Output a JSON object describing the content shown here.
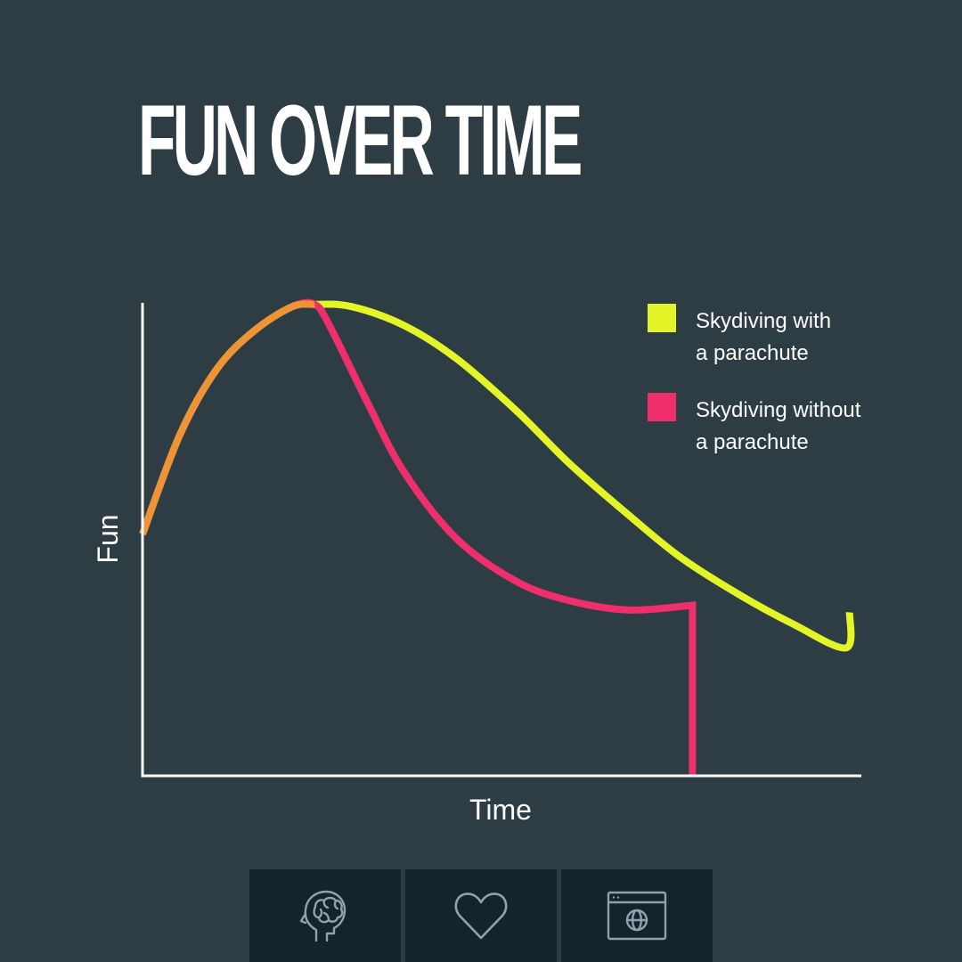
{
  "colors": {
    "background": "#2e3c44",
    "axis": "#ffffff",
    "text": "#ffffff",
    "icon_tile": "#14232c",
    "icon_stroke": "#8fa3ad"
  },
  "chart_data": {
    "type": "line",
    "title": "FUN OVER TIME",
    "xlabel": "Time",
    "ylabel": "Fun",
    "xlim": [
      0,
      100
    ],
    "ylim": [
      0,
      100
    ],
    "grid": false,
    "tick_labels": false,
    "legend_position": "top-right",
    "series": [
      {
        "name": "Skydiving with\na parachute",
        "name_lines": [
          "Skydiving with",
          "a parachute"
        ],
        "color": "#e4f527",
        "x": [
          0,
          5,
          10,
          15,
          20,
          23,
          28,
          35,
          42,
          50,
          57,
          65,
          72,
          80,
          87,
          94,
          99
        ],
        "y": [
          51,
          72,
          86,
          94,
          99,
          99.5,
          99,
          95,
          88,
          77,
          66,
          55,
          46,
          38,
          32,
          27,
          34.5
        ]
      },
      {
        "name": "Skydiving without\na parachute",
        "name_lines": [
          "Skydiving without",
          "a parachute"
        ],
        "color": "#ef2f6c",
        "x": [
          0,
          5,
          10,
          15,
          20,
          23,
          25,
          30,
          35,
          42,
          50,
          57,
          65,
          73.5,
          73.5
        ],
        "y": [
          51,
          72,
          86,
          94,
          99,
          99.5,
          95,
          79,
          64,
          50,
          41,
          37,
          35,
          36,
          0
        ]
      }
    ],
    "overlap_color": "#ec9436"
  },
  "icons": [
    {
      "name": "brain-head-icon"
    },
    {
      "name": "heart-icon"
    },
    {
      "name": "browser-globe-icon"
    }
  ]
}
